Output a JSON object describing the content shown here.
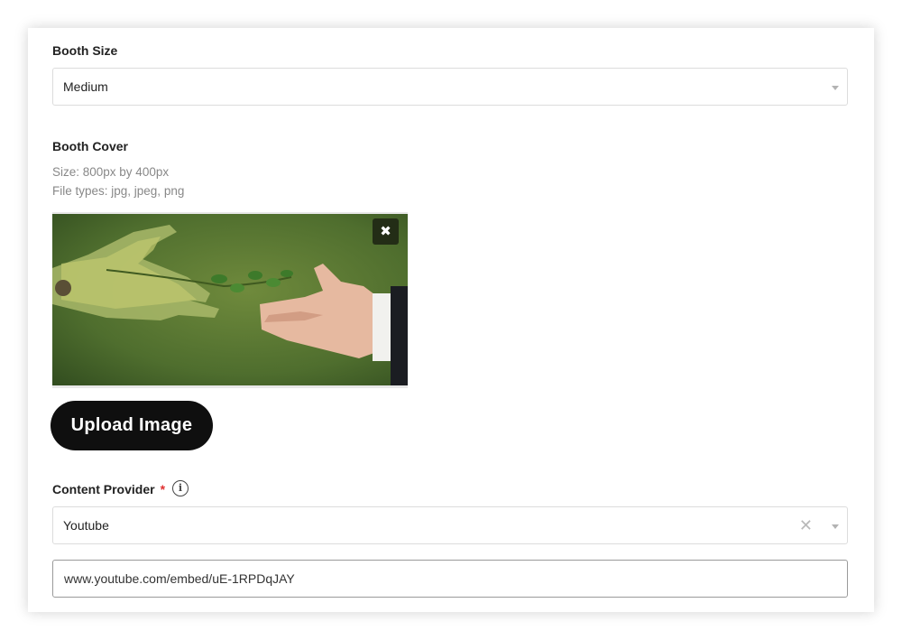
{
  "booth_size": {
    "label": "Booth Size",
    "selected": "Medium"
  },
  "booth_cover": {
    "label": "Booth Cover",
    "size_hint": "Size: 800px by 400px",
    "filetypes_hint": "File types: jpg, jpeg, png",
    "remove_symbol": "✖"
  },
  "upload_button": "Upload Image",
  "content_provider": {
    "label": "Content Provider",
    "required_mark": "*",
    "info_symbol": "i",
    "selected": "Youtube",
    "clear_symbol": "✕",
    "url_value": "www.youtube.com/embed/uE-1RPDqJAY"
  },
  "colors": {
    "button_bg": "#0f0f0f",
    "required": "#e03131",
    "remove_bg": "#232d16"
  }
}
